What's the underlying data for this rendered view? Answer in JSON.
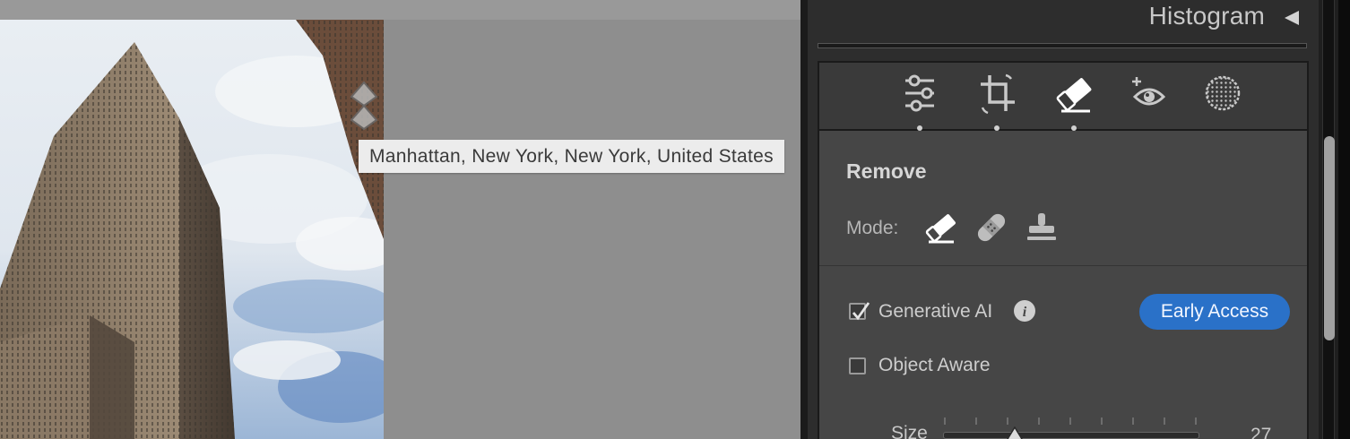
{
  "canvas": {
    "tooltip": "Manhattan, New York, New York, United States"
  },
  "panel": {
    "histogram_title": "Histogram",
    "tools": [
      {
        "name": "edit-sliders-icon"
      },
      {
        "name": "crop-icon"
      },
      {
        "name": "eraser-icon",
        "active": true
      },
      {
        "name": "red-eye-icon"
      },
      {
        "name": "masking-icon"
      }
    ],
    "remove": {
      "title": "Remove",
      "mode_label": "Mode:",
      "modes": [
        "remove-eraser-icon",
        "heal-bandage-icon",
        "clone-stamp-icon"
      ],
      "generative_ai": {
        "label": "Generative AI",
        "checked": true
      },
      "early_access_label": "Early Access",
      "object_aware": {
        "label": "Object Aware",
        "checked": false
      },
      "size_label": "Size",
      "size_value": "27"
    }
  },
  "colors": {
    "accent": "#2a71c8",
    "panel_bg": "#464646",
    "canvas_bg": "#8e8e8e"
  }
}
